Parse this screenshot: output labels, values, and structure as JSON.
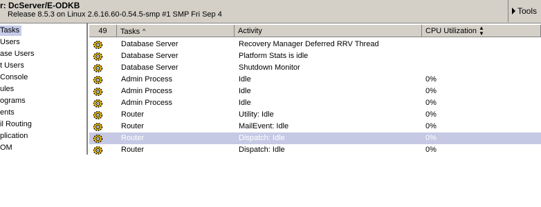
{
  "header": {
    "server_title": "r: DcServer/E-ODKB",
    "server_info": "Release 8.5.3 on Linux 2.6.16.60-0.54.5-smp #1 SMP Fri Sep 4",
    "tools_label": "Tools"
  },
  "sidebar": {
    "items": [
      {
        "label": "Tasks",
        "selected": true
      },
      {
        "label": "Users"
      },
      {
        "label": "ase Users"
      },
      {
        "label": "t Users"
      },
      {
        "label": "Console"
      },
      {
        "label": "ules"
      },
      {
        "label": "ograms"
      },
      {
        "label": "ents"
      },
      {
        "label": "il Routing"
      },
      {
        "label": "plication"
      },
      {
        "label": "OM"
      }
    ]
  },
  "tasks_table": {
    "count": "49",
    "columns": {
      "tasks": "Tasks",
      "activity": "Activity",
      "cpu": "CPU Utilization"
    },
    "rows": [
      {
        "task": "Database Server",
        "activity": "Recovery Manager Deferred RRV Thread",
        "cpu": ""
      },
      {
        "task": "Database Server",
        "activity": "Platform Stats is idle",
        "cpu": ""
      },
      {
        "task": "Database Server",
        "activity": "Shutdown Monitor",
        "cpu": ""
      },
      {
        "task": "Admin Process",
        "activity": "Idle",
        "cpu": "0%"
      },
      {
        "task": "Admin Process",
        "activity": "Idle",
        "cpu": "0%"
      },
      {
        "task": "Admin Process",
        "activity": "Idle",
        "cpu": "0%"
      },
      {
        "task": "Router",
        "activity": "Utility: Idle",
        "cpu": "0%"
      },
      {
        "task": "Router",
        "activity": "MailEvent: Idle",
        "cpu": "0%"
      },
      {
        "task": "Router",
        "activity": "Dispatch: Idle",
        "cpu": "0%",
        "selected": true
      },
      {
        "task": "Router",
        "activity": "Dispatch: Idle",
        "cpu": "0%"
      }
    ]
  }
}
